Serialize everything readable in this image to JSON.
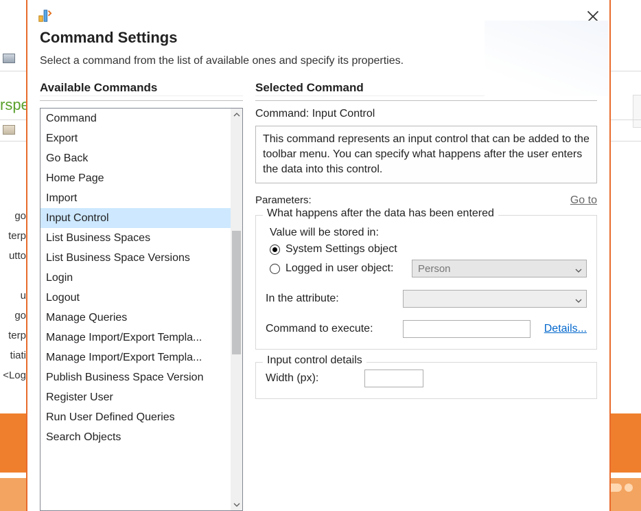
{
  "bg": {
    "green_text": "rspe",
    "left_items": "go\nterp\nutto\n\nu\ngo\nterp\ntiati\n<Log"
  },
  "dialog": {
    "title": "Command Settings",
    "subtitle": "Select a command from the list of available ones and specify its properties."
  },
  "left": {
    "heading": "Available Commands",
    "items": [
      "Command",
      "Export",
      "Go Back",
      "Home Page",
      "Import",
      "Input Control",
      "List Business Spaces",
      "List Business Space Versions",
      "Login",
      "Logout",
      "Manage Queries",
      "Manage Import/Export Templa...",
      "Manage Import/Export Templa...",
      "Publish Business Space Version",
      "Register User",
      "Run User Defined Queries",
      "Search Objects"
    ],
    "selected_index": 5
  },
  "right": {
    "heading": "Selected Command",
    "command_label": "Command:",
    "command_name": "Input Control",
    "description": "This command represents an input control that can be added to the toolbar menu. You can specify what happens after the user enters the data into this control.",
    "parameters_label": "Parameters:",
    "goto_label": "Go to",
    "group1": {
      "legend": "What happens after the data has been entered",
      "stored_in_label": "Value will be stored in:",
      "radio_system": "System Settings object",
      "radio_user": "Logged in user object:",
      "user_select_value": "Person",
      "attribute_label": "In the attribute:",
      "attribute_value": "",
      "execute_label": "Command to execute:",
      "execute_value": "",
      "details_label": "Details..."
    },
    "group2": {
      "legend": "Input control details",
      "width_label": "Width (px):",
      "width_value": ""
    }
  }
}
